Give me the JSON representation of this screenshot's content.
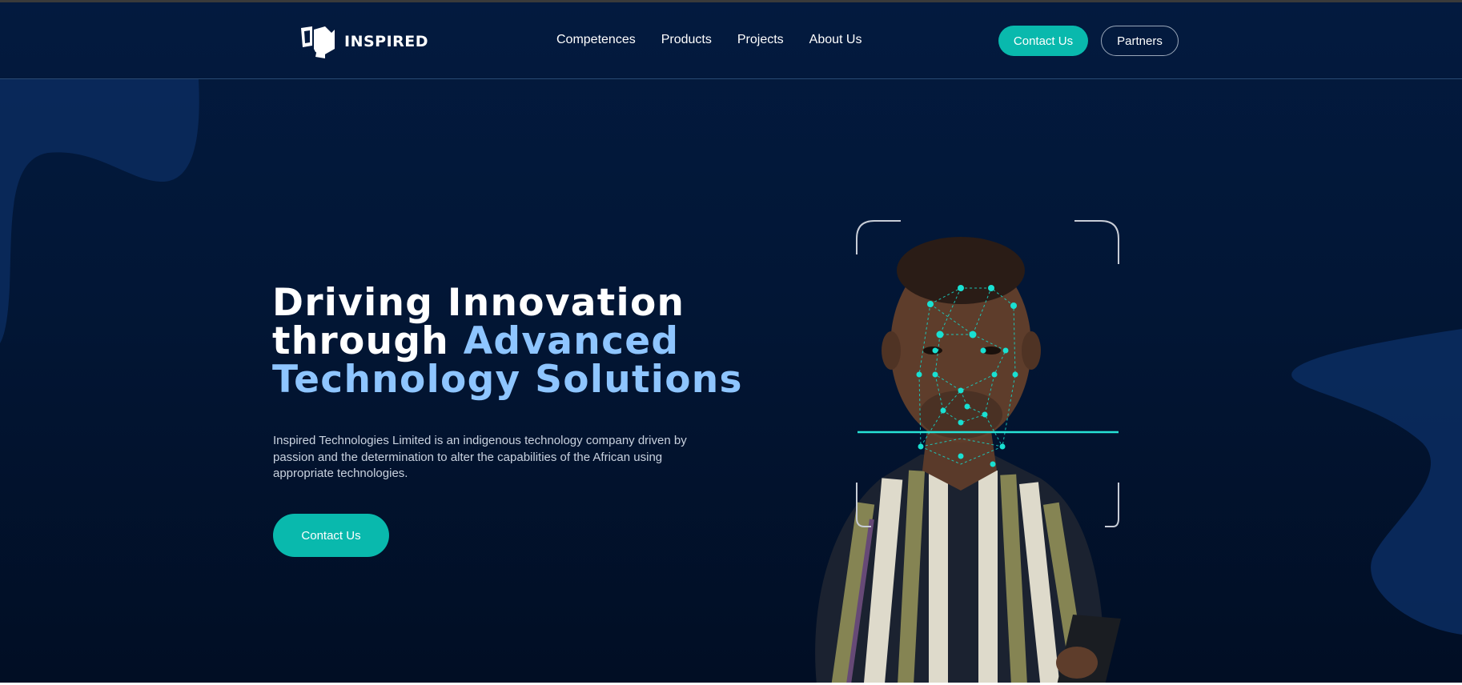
{
  "brand": {
    "name": "INSPIRED"
  },
  "nav": {
    "links": [
      "Competences",
      "Products",
      "Projects",
      "About Us"
    ],
    "contact_label": "Contact Us",
    "partners_label": "Partners"
  },
  "hero": {
    "headline_line1": "Driving Innovation",
    "headline_line2_plain": "through ",
    "headline_line2_accent": "Advanced",
    "headline_line3_accent": "Technology Solutions",
    "description": "Inspired Technologies Limited is an indigenous technology company driven by passion and the determination to alter the capabilities of the African using appropriate technologies.",
    "cta_label": "Contact Us",
    "image_subject": "man with facial-recognition mesh overlay holding a smartphone"
  },
  "colors": {
    "background": "#021635",
    "accent_teal": "#09b9ad",
    "accent_blue_text": "#8ec5ff",
    "blob": "#0a2b5e"
  }
}
